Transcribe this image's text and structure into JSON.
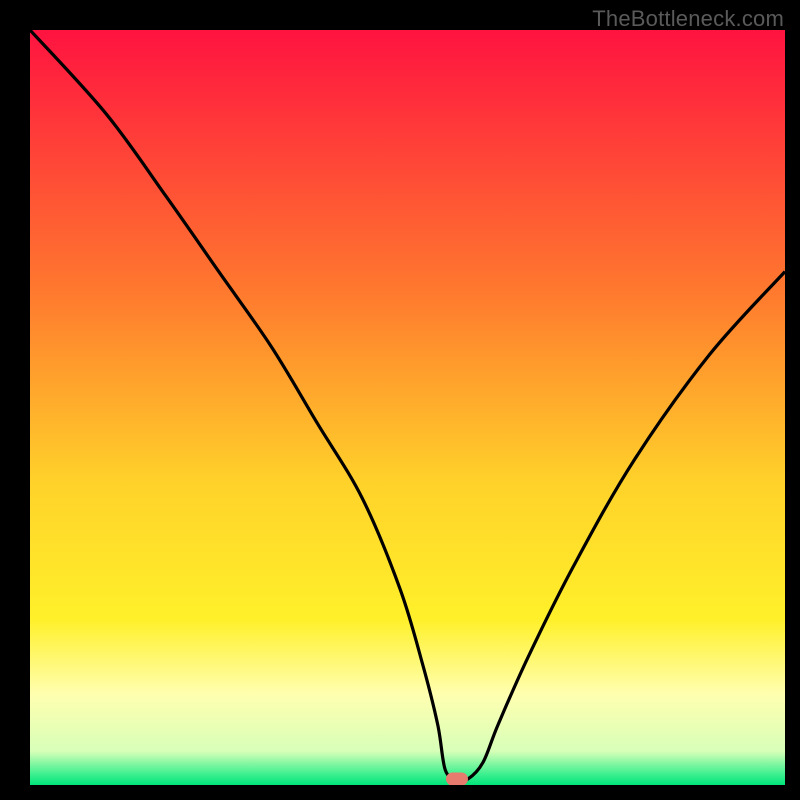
{
  "watermark": "TheBottleneck.com",
  "colors": {
    "red_top": "#ff1340",
    "orange_mid": "#ff9b2a",
    "yellow": "#fff02a",
    "pale_yellow": "#ffffb0",
    "green": "#00e57a",
    "curve": "#000000",
    "marker": "#e77b6e",
    "frame": "#000000"
  },
  "marker": {
    "x_frac": 0.565,
    "y_frac": 0.992
  },
  "chart_data": {
    "type": "line",
    "title": "",
    "xlabel": "",
    "ylabel": "",
    "xlim": [
      0,
      100
    ],
    "ylim": [
      0,
      100
    ],
    "grid": false,
    "legend": false,
    "annotations": [],
    "series": [
      {
        "name": "bottleneck-curve",
        "x": [
          0,
          10,
          18,
          25,
          32,
          38,
          44,
          49,
          52,
          54,
          55,
          56.5,
          58,
          60,
          62,
          66,
          72,
          80,
          90,
          100
        ],
        "y": [
          100,
          89,
          78,
          68,
          58,
          48,
          38,
          26,
          16,
          8,
          2,
          0.8,
          0.8,
          3,
          8,
          17,
          29,
          43,
          57,
          68
        ]
      }
    ],
    "minimum_marker": {
      "x": 56.5,
      "y": 0.8
    },
    "background_gradient_stops": [
      {
        "pos": 0.0,
        "color": "#ff1340"
      },
      {
        "pos": 0.35,
        "color": "#ff7a2e"
      },
      {
        "pos": 0.6,
        "color": "#ffd22a"
      },
      {
        "pos": 0.78,
        "color": "#fff02a"
      },
      {
        "pos": 0.88,
        "color": "#ffffb0"
      },
      {
        "pos": 0.955,
        "color": "#d8ffb8"
      },
      {
        "pos": 0.985,
        "color": "#40f090"
      },
      {
        "pos": 1.0,
        "color": "#00e57a"
      }
    ]
  }
}
